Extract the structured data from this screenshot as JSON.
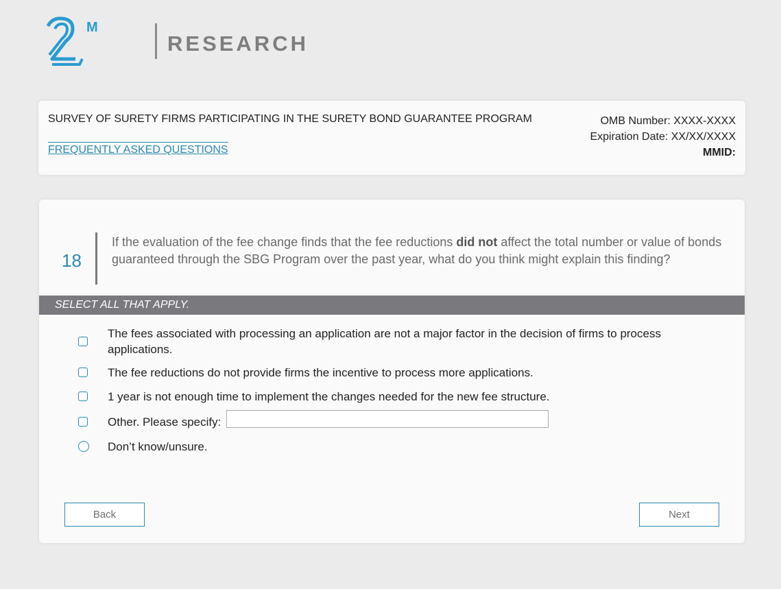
{
  "logo": {
    "mark": "2",
    "superscript": "M",
    "text": "RESEARCH",
    "brand_color": "#2a9bd1"
  },
  "header": {
    "survey_title": "SURVEY OF SURETY FIRMS PARTICIPATING IN THE SURETY BOND GUARANTEE PROGRAM",
    "faq_link": "FREQUENTLY ASKED QUESTIONS",
    "omb_number": "OMB Number: XXXX-XXXX",
    "expiration_date": "Expiration Date: XX/XX/XXXX",
    "mmid": "MMID:"
  },
  "question": {
    "number": "18",
    "text_before": "If the evaluation of the fee change finds that the fee reductions ",
    "text_bold": "did not",
    "text_after": " affect the total number or value of bonds guaranteed through the SBG Program over the past year, what do you think might explain this finding?",
    "instruction": "SELECT ALL THAT APPLY.",
    "options": [
      {
        "label": "The fees associated with processing an application are not a major factor in the decision of firms to process applications.",
        "type": "checkbox",
        "checked": false
      },
      {
        "label": "The fee reductions do not provide firms the incentive to process more applications.",
        "type": "checkbox",
        "checked": false
      },
      {
        "label": "1 year is not enough time to implement the changes needed for the new fee structure.",
        "type": "checkbox",
        "checked": false
      },
      {
        "label": "Other. Please specify:",
        "type": "checkbox",
        "checked": false,
        "input_value": ""
      },
      {
        "label": "Don’t know/unsure.",
        "type": "radio",
        "checked": false
      }
    ]
  },
  "nav": {
    "back_label": "Back",
    "next_label": "Next"
  },
  "colors": {
    "accent": "#2a8ab0",
    "instruction_bar": "#79797e",
    "background": "#ebebeb"
  }
}
